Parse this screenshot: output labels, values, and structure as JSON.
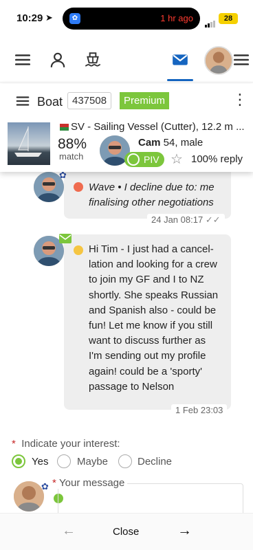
{
  "status_bar": {
    "time": "10:29",
    "notification": "1 hr ago",
    "battery": "28"
  },
  "nav": {
    "items": [
      "menu-icon",
      "profile-icon",
      "boat-icon",
      "mail-icon",
      "avatar",
      "menu-icon"
    ],
    "active": "mail-icon",
    "accent": "#1565c0"
  },
  "boat_card": {
    "label": "Boat",
    "id": "437508",
    "badge": "Premium",
    "vessel": "SV - Sailing Vessel (Cutter), 12.2 m ...",
    "match_pct": "88%",
    "match_label": "match",
    "captain_name": "Cam",
    "captain_info": " 54, male",
    "piv_label": "PIV",
    "reply_rate": "100% reply",
    "accent_green": "#7cc63c"
  },
  "messages": [
    {
      "lines": [
        "Wave • I decline due to: me",
        "finalising other negotiations"
      ],
      "time": "24 Jan 08:17",
      "dot_color": "#ef6b4f",
      "read_icon": "double-check-icon"
    },
    {
      "lines": [
        "Hi Tim - I just had a cancel-",
        "lation and looking for a crew",
        "to join my GF and I to NZ",
        "shortly. She speaks Russian",
        "and Spanish also - could be",
        "fun! Let me know if you still",
        "want to discuss further as",
        "I'm sending out my profile",
        "again! could be a 'sporty'",
        "passage to Nelson"
      ],
      "time": "1 Feb 23:03",
      "dot_color": "#f5c542"
    }
  ],
  "interest": {
    "label": "Indicate your interest:",
    "options": [
      "Yes",
      "Maybe",
      "Decline"
    ],
    "selected": "Yes"
  },
  "compose": {
    "label": "Your message"
  },
  "footer": {
    "close_label": "Close"
  }
}
